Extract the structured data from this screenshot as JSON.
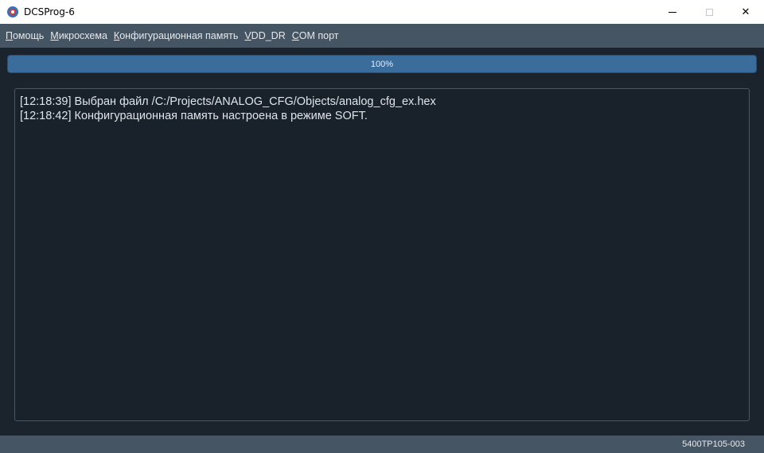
{
  "window": {
    "title": "DCSProg-6",
    "icon": "app-logo-icon",
    "controls": {
      "minimize": "minimize-icon",
      "maximize": "maximize-icon",
      "close_glyph": "✕"
    }
  },
  "menubar": {
    "items": [
      {
        "accel": "П",
        "rest": "омощь"
      },
      {
        "accel": "М",
        "rest": "икросхема"
      },
      {
        "accel": "К",
        "rest": "онфигурационная память"
      },
      {
        "accel": "V",
        "rest": "DD_DR"
      },
      {
        "accel": "C",
        "rest": "OM порт"
      }
    ]
  },
  "progress": {
    "value": 100,
    "label": "100%"
  },
  "log": {
    "lines": [
      "[12:18:39] Выбран файл /C:/Projects/ANALOG_CFG/Objects/analog_cfg_ex.hex",
      "[12:18:42] Конфигурационная память настроена в режиме SOFT."
    ]
  },
  "statusbar": {
    "device": "5400ТР105-003"
  },
  "colors": {
    "background": "#1b232c",
    "menubar": "#465564",
    "progress_fill": "#3a6c9c",
    "log_border": "#4a5866"
  }
}
